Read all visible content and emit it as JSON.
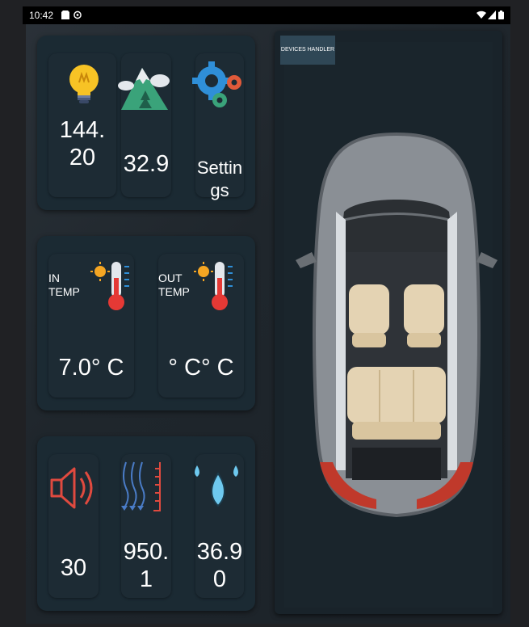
{
  "status_bar": {
    "time": "10:42"
  },
  "top_card": {
    "light_value": "144.\n20",
    "altitude_value": "32.9",
    "settings_label": "Settin\ngs"
  },
  "temp_card": {
    "in_label": "IN\nTEMP",
    "in_value": "7.0° C",
    "out_label": "OUT\nTEMP",
    "out_value": "° C° C"
  },
  "bottom_card": {
    "volume_value": "30",
    "pressure_value": "950.\n1",
    "humidity_value": "36.9\n0"
  },
  "devices_handler_label": "DEVICES HANDLER",
  "colors": {
    "background": "#202124",
    "card": "#1b2a33",
    "accent_button": "#2f4756",
    "speaker": "#e04a3f",
    "thermometer_red": "#e53935",
    "sun": "#f5a623"
  },
  "icons": [
    "lightbulb-icon",
    "mountain-icon",
    "gears-icon",
    "sun-thermometer-icon",
    "speaker-icon",
    "wind-pressure-icon",
    "water-drops-icon",
    "car-top-view"
  ]
}
